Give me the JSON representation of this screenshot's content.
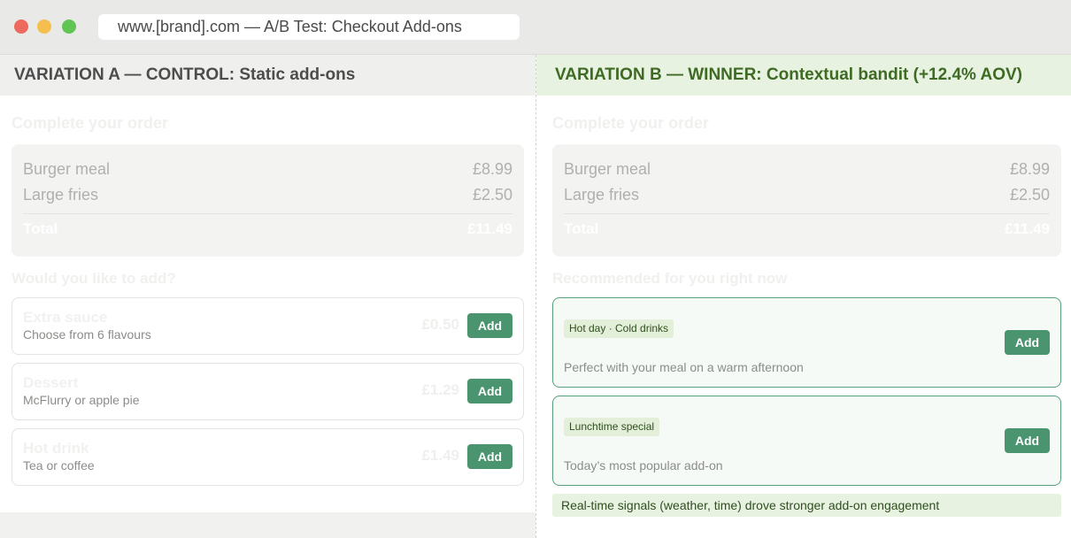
{
  "browser": {
    "url": "www.[brand].com — A/B Test: Checkout Add-ons"
  },
  "variation_a": {
    "header": "VARIATION A — CONTROL: Static add-ons",
    "title": "Complete your order",
    "order": [
      {
        "name": "Burger meal",
        "price": "£8.99"
      },
      {
        "name": "Large fries",
        "price": "£2.50"
      }
    ],
    "total_label": "Total",
    "total_value": "£11.49",
    "addons_title": "Would you like to add?",
    "addons": [
      {
        "name": "Extra sauce",
        "desc": "Choose from 6 flavours",
        "price": "£0.50",
        "button": "Add"
      },
      {
        "name": "Dessert",
        "desc": "McFlurry or apple pie",
        "price": "£1.29",
        "button": "Add"
      },
      {
        "name": "Hot drink",
        "desc": "Tea or coffee",
        "price": "£1.49",
        "button": "Add"
      }
    ]
  },
  "variation_b": {
    "header": "VARIATION B — WINNER: Contextual bandit (+12.4% AOV)",
    "title": "Complete your order",
    "order": [
      {
        "name": "Burger meal",
        "price": "£8.99"
      },
      {
        "name": "Large fries",
        "price": "£2.50"
      }
    ],
    "total_label": "Total",
    "total_value": "£11.49",
    "recs_title": "Recommended for you right now",
    "recs": [
      {
        "tag": "Hot day · Cold drinks",
        "desc": "Perfect with your meal on a warm afternoon",
        "button": "Add"
      },
      {
        "tag": "Lunchtime special",
        "desc": "Today’s most popular add-on",
        "button": "Add"
      }
    ],
    "insight": "Real-time signals (weather, time) drove stronger add-on engagement"
  },
  "colors": {
    "accent_green": "#4b9470",
    "winner_bg": "#e8f2e1",
    "winner_text": "#3e6a23"
  }
}
